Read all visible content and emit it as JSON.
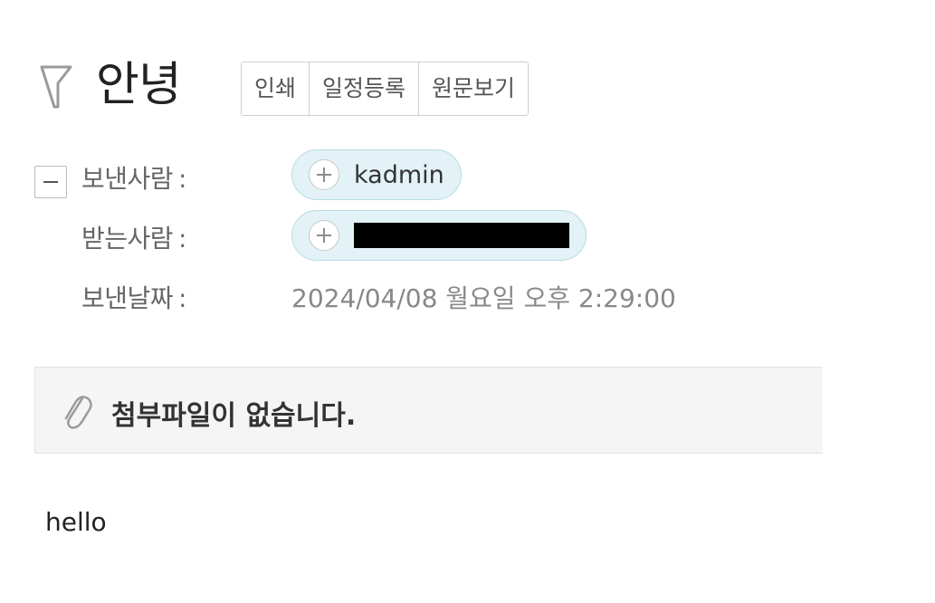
{
  "mail": {
    "subject": "안녕",
    "actions": {
      "print_label": "인쇄",
      "schedule_label": "일정등록",
      "view_source_label": "원문보기"
    },
    "sender": {
      "label": "보낸사람",
      "colon": ":",
      "name": "kadmin"
    },
    "recipient": {
      "label": "받는사람",
      "colon": ":"
    },
    "sent_date": {
      "label": "보낸날짜",
      "colon": ":",
      "value": "2024/04/08 월요일 오후 2:29:00"
    },
    "attachments": {
      "message": "첨부파일이 없습니다."
    },
    "body": "hello"
  },
  "icons": {
    "flag": "flag-icon",
    "collapse": "minus-icon",
    "add_contact": "plus-icon",
    "attachment": "paperclip-icon"
  },
  "colors": {
    "chip_bg": "#e2f2f6",
    "chip_border": "#b9dbe3",
    "attach_bg": "#f5f5f5"
  }
}
